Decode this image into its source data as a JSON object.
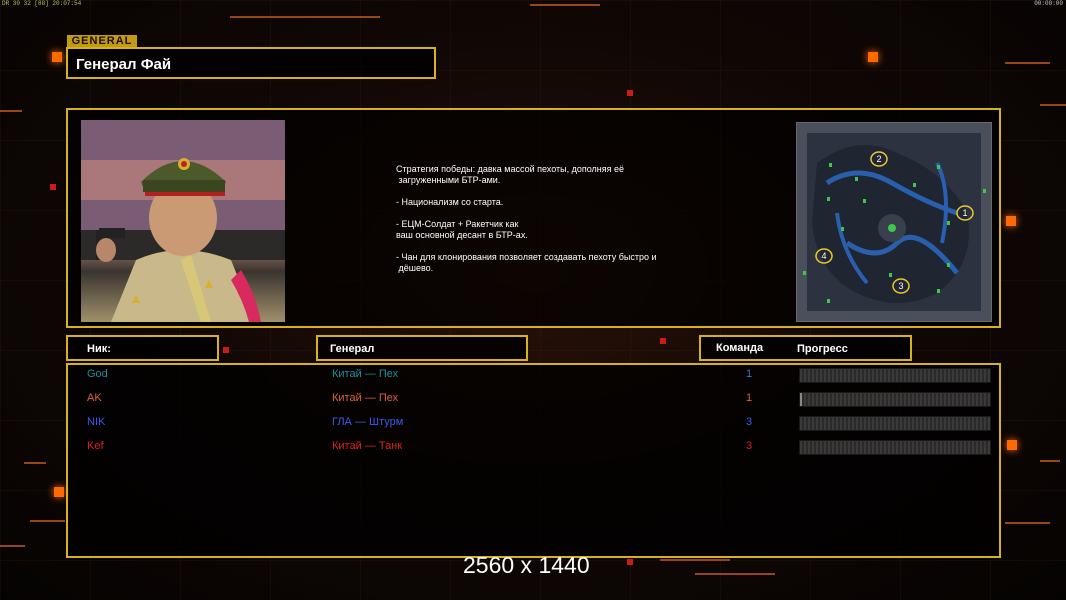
{
  "hud": {
    "left_status": "DR 30 32 [88] 20:07:54",
    "right_clock": "00:00:00"
  },
  "general": {
    "tag": "GENERAL",
    "name": "Генерал Фай"
  },
  "description": [
    "Стратегия победы: давка массой пехоты, дополняя её",
    " загруженными БТР-ами.",
    "",
    "- Национализм со старта.",
    "",
    "- ЕЦМ-Солдат + Ракетчик как",
    "ваш основной десант в БТР-ах.",
    "",
    "- Чан для клонирования позволяет создавать пехоту быстро и",
    " дёшево."
  ],
  "minimap": {
    "start_positions": [
      "1",
      "2",
      "3",
      "4"
    ]
  },
  "table": {
    "headers": {
      "nick": "Ник:",
      "general": "Генерал",
      "team": "Команда",
      "progress": "Прогресс"
    },
    "rows": [
      {
        "nick": "God",
        "general": "Китай — Пех",
        "team": "1",
        "color": "#1f8f9a",
        "team_color": "#2b7fd6",
        "progress": 0
      },
      {
        "nick": "AK",
        "general": "Китай — Пех",
        "team": "1",
        "color": "#e0603a",
        "team_color": "#e0603a",
        "progress": 0.01
      },
      {
        "nick": "NIK",
        "general": "ГЛА — Штурм",
        "team": "3",
        "color": "#3a5cf0",
        "team_color": "#3a5cf0",
        "progress": 0
      },
      {
        "nick": "Kef",
        "general": "Китай — Танк",
        "team": "3",
        "color": "#e02020",
        "team_color": "#e02020",
        "progress": 0
      }
    ]
  },
  "watermark": "2560 x 1440",
  "colors": {
    "frame": "#d7b21e",
    "accent": "#ff6a00"
  }
}
